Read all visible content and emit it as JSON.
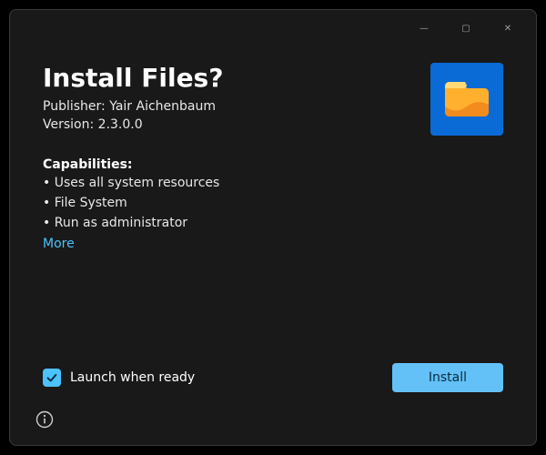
{
  "titlebar": {
    "minimize_glyph": "—",
    "maximize_glyph": "▢",
    "close_glyph": "✕"
  },
  "header": {
    "title": "Install Files?",
    "publisher_label": "Publisher:",
    "publisher_value": "Yair Aichenbaum",
    "version_label": "Version:",
    "version_value": "2.3.0.0"
  },
  "capabilities": {
    "title": "Capabilities:",
    "items": [
      "Uses all system resources",
      "File System",
      "Run as administrator"
    ],
    "more_label": "More"
  },
  "footer": {
    "launch_label": "Launch when ready",
    "launch_checked": true,
    "install_label": "Install"
  },
  "colors": {
    "accent": "#4cc2ff",
    "install_button": "#63c1f7",
    "icon_bg": "#0a6ad6",
    "window_bg": "#191919"
  },
  "icons": {
    "app": "folder-icon",
    "info": "info-icon",
    "check": "check-icon"
  }
}
